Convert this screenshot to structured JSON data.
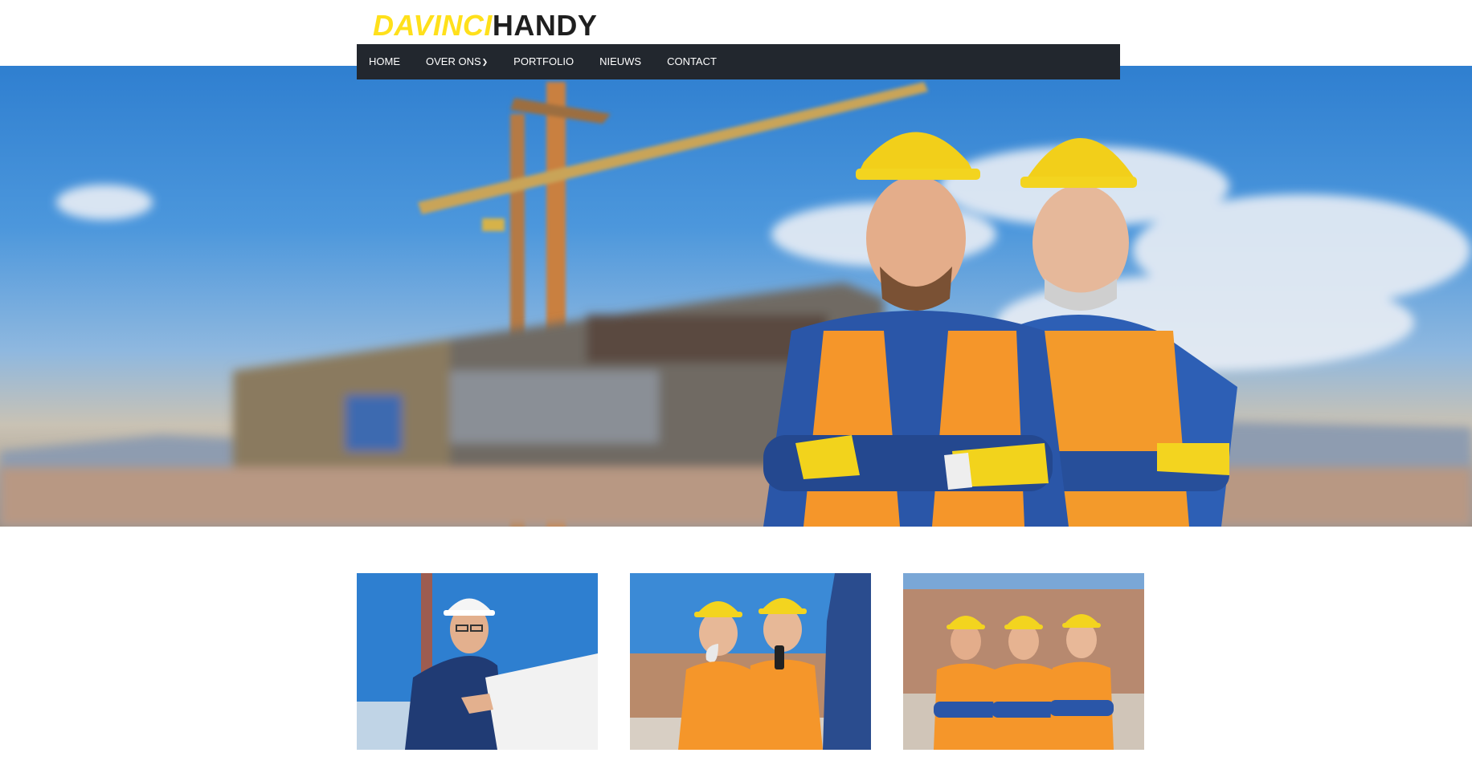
{
  "brand": {
    "part1": "DAVINCI",
    "part2": "HANDY",
    "accent": "#ffe01b",
    "dark": "#1f1f1f"
  },
  "nav": {
    "background": "#22272e",
    "items": [
      {
        "label": "HOME"
      },
      {
        "label": "OVER ONS",
        "icon": "chevron-down-icon"
      },
      {
        "label": "PORTFOLIO"
      },
      {
        "label": "NIEUWS"
      },
      {
        "label": "CONTACT"
      }
    ]
  },
  "hero": {
    "image": "construction-workers-hero"
  },
  "gallery": [
    {
      "image": "engineer-with-blueprint"
    },
    {
      "image": "workers-with-walkie-talkie"
    },
    {
      "image": "three-workers-crossed-arms"
    }
  ]
}
